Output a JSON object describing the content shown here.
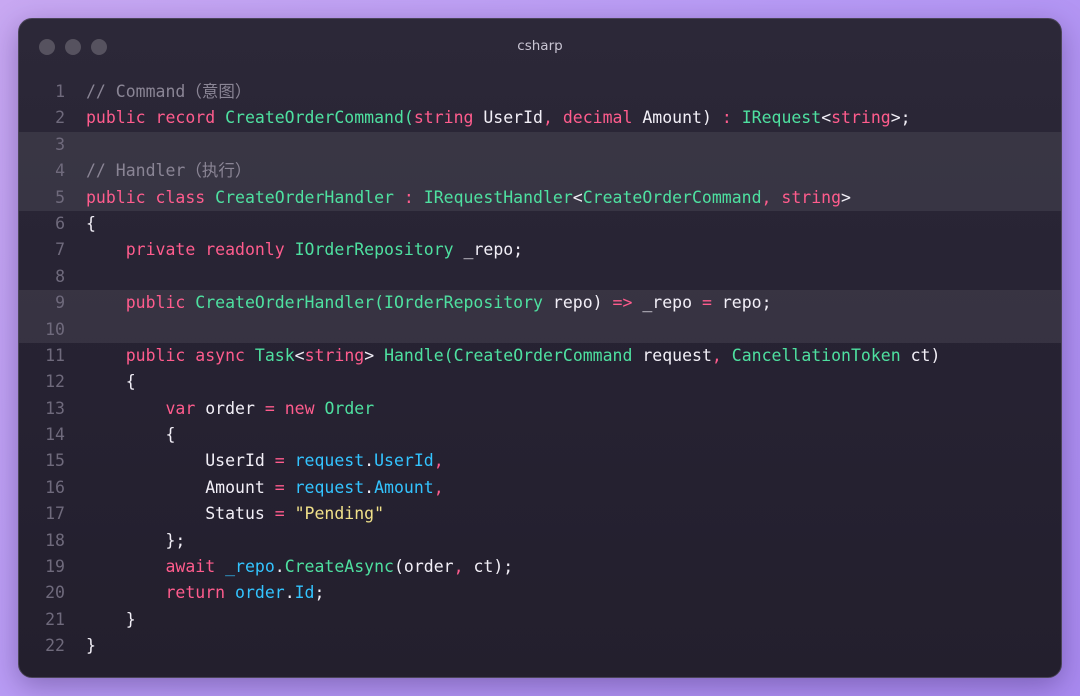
{
  "window": {
    "title": "csharp"
  },
  "colors": {
    "comment": "#8a8595",
    "keyword": "#ff5c8d",
    "type": "#4ee0a0",
    "plain": "#f2eff7",
    "property": "#33c4ff",
    "string": "#f0e08a",
    "line_number": "#6f6a7c",
    "highlight_band": "#3a3546"
  },
  "code": {
    "language": "csharp",
    "lines": [
      {
        "n": "1",
        "hl": false,
        "tokens": [
          {
            "t": "// Command（意图）",
            "c": "cm"
          }
        ]
      },
      {
        "n": "2",
        "hl": false,
        "tokens": [
          {
            "t": "public record ",
            "c": "kw"
          },
          {
            "t": "CreateOrderCommand(",
            "c": "ty"
          },
          {
            "t": "string ",
            "c": "kw"
          },
          {
            "t": "UserId",
            "c": "pl"
          },
          {
            "t": ", ",
            "c": "kw"
          },
          {
            "t": "decimal ",
            "c": "kw"
          },
          {
            "t": "Amount",
            "c": "pl"
          },
          {
            "t": ") ",
            "c": "pl"
          },
          {
            "t": ": ",
            "c": "kw"
          },
          {
            "t": "IRequest",
            "c": "ty"
          },
          {
            "t": "<",
            "c": "pl"
          },
          {
            "t": "string",
            "c": "kw"
          },
          {
            "t": ">;",
            "c": "pl"
          }
        ]
      },
      {
        "n": "3",
        "hl": true,
        "tokens": []
      },
      {
        "n": "4",
        "hl": true,
        "tokens": [
          {
            "t": "// Handler（执行）",
            "c": "cm"
          }
        ]
      },
      {
        "n": "5",
        "hl": true,
        "tokens": [
          {
            "t": "public class ",
            "c": "kw"
          },
          {
            "t": "CreateOrderHandler ",
            "c": "ty"
          },
          {
            "t": ": ",
            "c": "kw"
          },
          {
            "t": "IRequestHandler",
            "c": "ty"
          },
          {
            "t": "<",
            "c": "pl"
          },
          {
            "t": "CreateOrderCommand",
            "c": "ty"
          },
          {
            "t": ", ",
            "c": "kw"
          },
          {
            "t": "string",
            "c": "kw"
          },
          {
            "t": ">",
            "c": "pl"
          }
        ]
      },
      {
        "n": "6",
        "hl": false,
        "tokens": [
          {
            "t": "{",
            "c": "pl"
          }
        ]
      },
      {
        "n": "7",
        "hl": false,
        "tokens": [
          {
            "t": "    private readonly ",
            "c": "kw"
          },
          {
            "t": "IOrderRepository ",
            "c": "ty"
          },
          {
            "t": "_repo;",
            "c": "pl"
          }
        ]
      },
      {
        "n": "8",
        "hl": false,
        "tokens": []
      },
      {
        "n": "9",
        "hl": true,
        "tokens": [
          {
            "t": "    public ",
            "c": "kw"
          },
          {
            "t": "CreateOrderHandler(",
            "c": "ty"
          },
          {
            "t": "IOrderRepository ",
            "c": "ty"
          },
          {
            "t": "repo) ",
            "c": "pl"
          },
          {
            "t": "=> ",
            "c": "kw"
          },
          {
            "t": "_repo ",
            "c": "pl"
          },
          {
            "t": "= ",
            "c": "kw"
          },
          {
            "t": "repo;",
            "c": "pl"
          }
        ]
      },
      {
        "n": "10",
        "hl": true,
        "tokens": []
      },
      {
        "n": "11",
        "hl": false,
        "tokens": [
          {
            "t": "    public async ",
            "c": "kw"
          },
          {
            "t": "Task",
            "c": "ty"
          },
          {
            "t": "<",
            "c": "pl"
          },
          {
            "t": "string",
            "c": "kw"
          },
          {
            "t": "> ",
            "c": "pl"
          },
          {
            "t": "Handle(",
            "c": "ty"
          },
          {
            "t": "CreateOrderCommand ",
            "c": "ty"
          },
          {
            "t": "request",
            "c": "pl"
          },
          {
            "t": ", ",
            "c": "kw"
          },
          {
            "t": "CancellationToken ",
            "c": "ty"
          },
          {
            "t": "ct)",
            "c": "pl"
          }
        ]
      },
      {
        "n": "12",
        "hl": false,
        "tokens": [
          {
            "t": "    {",
            "c": "pl"
          }
        ]
      },
      {
        "n": "13",
        "hl": false,
        "tokens": [
          {
            "t": "        var ",
            "c": "kw"
          },
          {
            "t": "order ",
            "c": "pl"
          },
          {
            "t": "= ",
            "c": "kw"
          },
          {
            "t": "new ",
            "c": "kw"
          },
          {
            "t": "Order",
            "c": "ty"
          }
        ]
      },
      {
        "n": "14",
        "hl": false,
        "tokens": [
          {
            "t": "        {",
            "c": "pl"
          }
        ]
      },
      {
        "n": "15",
        "hl": false,
        "tokens": [
          {
            "t": "            UserId ",
            "c": "pl"
          },
          {
            "t": "= ",
            "c": "kw"
          },
          {
            "t": "request",
            "c": "pr"
          },
          {
            "t": ".",
            "c": "pl"
          },
          {
            "t": "UserId",
            "c": "pr"
          },
          {
            "t": ",",
            "c": "kw"
          }
        ]
      },
      {
        "n": "16",
        "hl": false,
        "tokens": [
          {
            "t": "            Amount ",
            "c": "pl"
          },
          {
            "t": "= ",
            "c": "kw"
          },
          {
            "t": "request",
            "c": "pr"
          },
          {
            "t": ".",
            "c": "pl"
          },
          {
            "t": "Amount",
            "c": "pr"
          },
          {
            "t": ",",
            "c": "kw"
          }
        ]
      },
      {
        "n": "17",
        "hl": false,
        "tokens": [
          {
            "t": "            Status ",
            "c": "pl"
          },
          {
            "t": "= ",
            "c": "kw"
          },
          {
            "t": "\"Pending\"",
            "c": "st"
          }
        ]
      },
      {
        "n": "18",
        "hl": false,
        "tokens": [
          {
            "t": "        };",
            "c": "pl"
          }
        ]
      },
      {
        "n": "19",
        "hl": false,
        "tokens": [
          {
            "t": "        await ",
            "c": "kw"
          },
          {
            "t": "_repo",
            "c": "pr"
          },
          {
            "t": ".",
            "c": "pl"
          },
          {
            "t": "CreateAsync",
            "c": "ty"
          },
          {
            "t": "(order",
            "c": "pl"
          },
          {
            "t": ", ",
            "c": "kw"
          },
          {
            "t": "ct);",
            "c": "pl"
          }
        ]
      },
      {
        "n": "20",
        "hl": false,
        "tokens": [
          {
            "t": "        return ",
            "c": "kw"
          },
          {
            "t": "order",
            "c": "pr"
          },
          {
            "t": ".",
            "c": "pl"
          },
          {
            "t": "Id",
            "c": "pr"
          },
          {
            "t": ";",
            "c": "pl"
          }
        ]
      },
      {
        "n": "21",
        "hl": false,
        "tokens": [
          {
            "t": "    }",
            "c": "pl"
          }
        ]
      },
      {
        "n": "22",
        "hl": false,
        "tokens": [
          {
            "t": "}",
            "c": "pl"
          }
        ]
      }
    ]
  }
}
